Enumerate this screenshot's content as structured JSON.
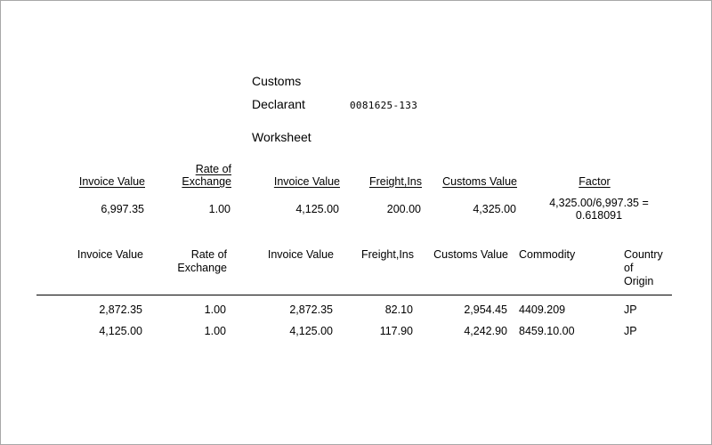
{
  "document": {
    "title_lines": [
      "Customs",
      "Worksheet"
    ],
    "declarant_label": "Declarant",
    "declarant_value": "0081625-133"
  },
  "summary_table": {
    "headers": [
      {
        "lines": [
          "Invoice Value"
        ]
      },
      {
        "lines": [
          "Rate of",
          "Exchange"
        ]
      },
      {
        "lines": [
          "Invoice Value"
        ]
      },
      {
        "lines": [
          "Freight,Ins"
        ]
      },
      {
        "lines": [
          "Customs Value"
        ]
      },
      {
        "lines": [
          "Factor"
        ]
      }
    ],
    "row": {
      "invoice_value_foreign": "6,997.35",
      "rate_of_exchange": "1.00",
      "invoice_value_local": "4,125.00",
      "freight_ins": "200.00",
      "customs_value": "4,325.00",
      "factor": "4,325.00/6,997.35 = 0.618091"
    }
  },
  "detail_table": {
    "headers": [
      {
        "lines": [
          "Invoice Value"
        ]
      },
      {
        "lines": [
          "Rate of",
          "Exchange"
        ]
      },
      {
        "lines": [
          "Invoice Value"
        ]
      },
      {
        "lines": [
          "Freight,Ins"
        ]
      },
      {
        "lines": [
          "Customs Value"
        ]
      },
      {
        "lines": [
          "Commodity"
        ]
      },
      {
        "lines": [
          "Country of",
          "Origin"
        ]
      }
    ],
    "rows": [
      {
        "invoice_value_foreign": "2,872.35",
        "rate_of_exchange": "1.00",
        "invoice_value_local": "2,872.35",
        "freight_ins": "82.10",
        "customs_value": "2,954.45",
        "commodity": "4409.209",
        "country_of_origin": "JP"
      },
      {
        "invoice_value_foreign": "4,125.00",
        "rate_of_exchange": "1.00",
        "invoice_value_local": "4,125.00",
        "freight_ins": "117.90",
        "customs_value": "4,242.90",
        "commodity": "8459.10.00",
        "country_of_origin": "JP"
      }
    ]
  },
  "colors": {
    "page_background": "#ffffff",
    "page_border": "#a8a8a8",
    "text": "#000000",
    "rule": "#000000"
  }
}
